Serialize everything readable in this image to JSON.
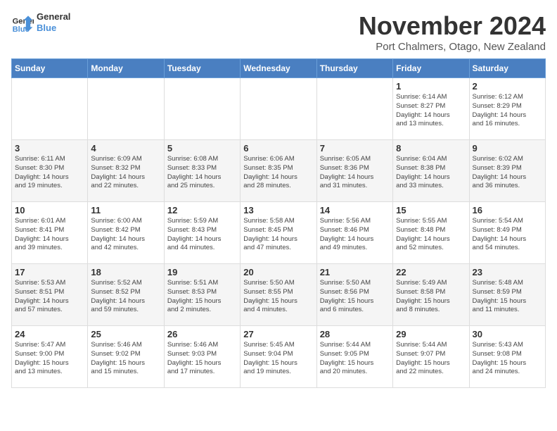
{
  "logo": {
    "line1": "General",
    "line2": "Blue"
  },
  "title": "November 2024",
  "location": "Port Chalmers, Otago, New Zealand",
  "days_of_week": [
    "Sunday",
    "Monday",
    "Tuesday",
    "Wednesday",
    "Thursday",
    "Friday",
    "Saturday"
  ],
  "weeks": [
    [
      {
        "day": "",
        "detail": ""
      },
      {
        "day": "",
        "detail": ""
      },
      {
        "day": "",
        "detail": ""
      },
      {
        "day": "",
        "detail": ""
      },
      {
        "day": "",
        "detail": ""
      },
      {
        "day": "1",
        "detail": "Sunrise: 6:14 AM\nSunset: 8:27 PM\nDaylight: 14 hours\nand 13 minutes."
      },
      {
        "day": "2",
        "detail": "Sunrise: 6:12 AM\nSunset: 8:29 PM\nDaylight: 14 hours\nand 16 minutes."
      }
    ],
    [
      {
        "day": "3",
        "detail": "Sunrise: 6:11 AM\nSunset: 8:30 PM\nDaylight: 14 hours\nand 19 minutes."
      },
      {
        "day": "4",
        "detail": "Sunrise: 6:09 AM\nSunset: 8:32 PM\nDaylight: 14 hours\nand 22 minutes."
      },
      {
        "day": "5",
        "detail": "Sunrise: 6:08 AM\nSunset: 8:33 PM\nDaylight: 14 hours\nand 25 minutes."
      },
      {
        "day": "6",
        "detail": "Sunrise: 6:06 AM\nSunset: 8:35 PM\nDaylight: 14 hours\nand 28 minutes."
      },
      {
        "day": "7",
        "detail": "Sunrise: 6:05 AM\nSunset: 8:36 PM\nDaylight: 14 hours\nand 31 minutes."
      },
      {
        "day": "8",
        "detail": "Sunrise: 6:04 AM\nSunset: 8:38 PM\nDaylight: 14 hours\nand 33 minutes."
      },
      {
        "day": "9",
        "detail": "Sunrise: 6:02 AM\nSunset: 8:39 PM\nDaylight: 14 hours\nand 36 minutes."
      }
    ],
    [
      {
        "day": "10",
        "detail": "Sunrise: 6:01 AM\nSunset: 8:41 PM\nDaylight: 14 hours\nand 39 minutes."
      },
      {
        "day": "11",
        "detail": "Sunrise: 6:00 AM\nSunset: 8:42 PM\nDaylight: 14 hours\nand 42 minutes."
      },
      {
        "day": "12",
        "detail": "Sunrise: 5:59 AM\nSunset: 8:43 PM\nDaylight: 14 hours\nand 44 minutes."
      },
      {
        "day": "13",
        "detail": "Sunrise: 5:58 AM\nSunset: 8:45 PM\nDaylight: 14 hours\nand 47 minutes."
      },
      {
        "day": "14",
        "detail": "Sunrise: 5:56 AM\nSunset: 8:46 PM\nDaylight: 14 hours\nand 49 minutes."
      },
      {
        "day": "15",
        "detail": "Sunrise: 5:55 AM\nSunset: 8:48 PM\nDaylight: 14 hours\nand 52 minutes."
      },
      {
        "day": "16",
        "detail": "Sunrise: 5:54 AM\nSunset: 8:49 PM\nDaylight: 14 hours\nand 54 minutes."
      }
    ],
    [
      {
        "day": "17",
        "detail": "Sunrise: 5:53 AM\nSunset: 8:51 PM\nDaylight: 14 hours\nand 57 minutes."
      },
      {
        "day": "18",
        "detail": "Sunrise: 5:52 AM\nSunset: 8:52 PM\nDaylight: 14 hours\nand 59 minutes."
      },
      {
        "day": "19",
        "detail": "Sunrise: 5:51 AM\nSunset: 8:53 PM\nDaylight: 15 hours\nand 2 minutes."
      },
      {
        "day": "20",
        "detail": "Sunrise: 5:50 AM\nSunset: 8:55 PM\nDaylight: 15 hours\nand 4 minutes."
      },
      {
        "day": "21",
        "detail": "Sunrise: 5:50 AM\nSunset: 8:56 PM\nDaylight: 15 hours\nand 6 minutes."
      },
      {
        "day": "22",
        "detail": "Sunrise: 5:49 AM\nSunset: 8:58 PM\nDaylight: 15 hours\nand 8 minutes."
      },
      {
        "day": "23",
        "detail": "Sunrise: 5:48 AM\nSunset: 8:59 PM\nDaylight: 15 hours\nand 11 minutes."
      }
    ],
    [
      {
        "day": "24",
        "detail": "Sunrise: 5:47 AM\nSunset: 9:00 PM\nDaylight: 15 hours\nand 13 minutes."
      },
      {
        "day": "25",
        "detail": "Sunrise: 5:46 AM\nSunset: 9:02 PM\nDaylight: 15 hours\nand 15 minutes."
      },
      {
        "day": "26",
        "detail": "Sunrise: 5:46 AM\nSunset: 9:03 PM\nDaylight: 15 hours\nand 17 minutes."
      },
      {
        "day": "27",
        "detail": "Sunrise: 5:45 AM\nSunset: 9:04 PM\nDaylight: 15 hours\nand 19 minutes."
      },
      {
        "day": "28",
        "detail": "Sunrise: 5:44 AM\nSunset: 9:05 PM\nDaylight: 15 hours\nand 20 minutes."
      },
      {
        "day": "29",
        "detail": "Sunrise: 5:44 AM\nSunset: 9:07 PM\nDaylight: 15 hours\nand 22 minutes."
      },
      {
        "day": "30",
        "detail": "Sunrise: 5:43 AM\nSunset: 9:08 PM\nDaylight: 15 hours\nand 24 minutes."
      }
    ]
  ]
}
